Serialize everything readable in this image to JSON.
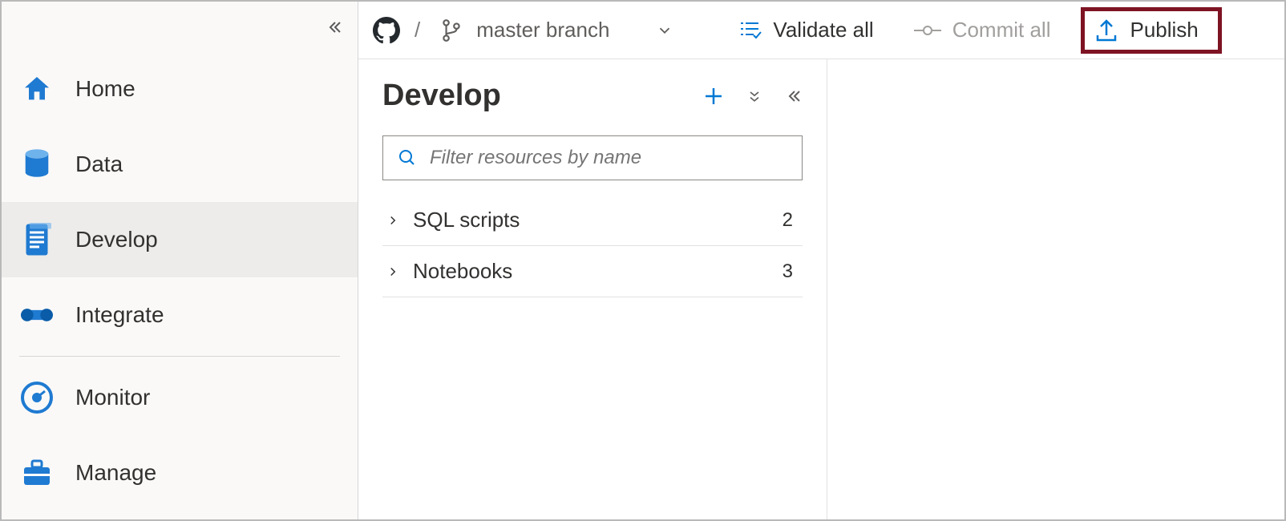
{
  "sidebar": {
    "items": [
      {
        "label": "Home"
      },
      {
        "label": "Data"
      },
      {
        "label": "Develop"
      },
      {
        "label": "Integrate"
      },
      {
        "label": "Monitor"
      },
      {
        "label": "Manage"
      }
    ]
  },
  "topbar": {
    "branch_label": "master branch",
    "validate_label": "Validate all",
    "commit_label": "Commit all",
    "publish_label": "Publish"
  },
  "panel": {
    "title": "Develop",
    "filter_placeholder": "Filter resources by name",
    "tree": [
      {
        "label": "SQL scripts",
        "count": "2"
      },
      {
        "label": "Notebooks",
        "count": "3"
      }
    ]
  }
}
